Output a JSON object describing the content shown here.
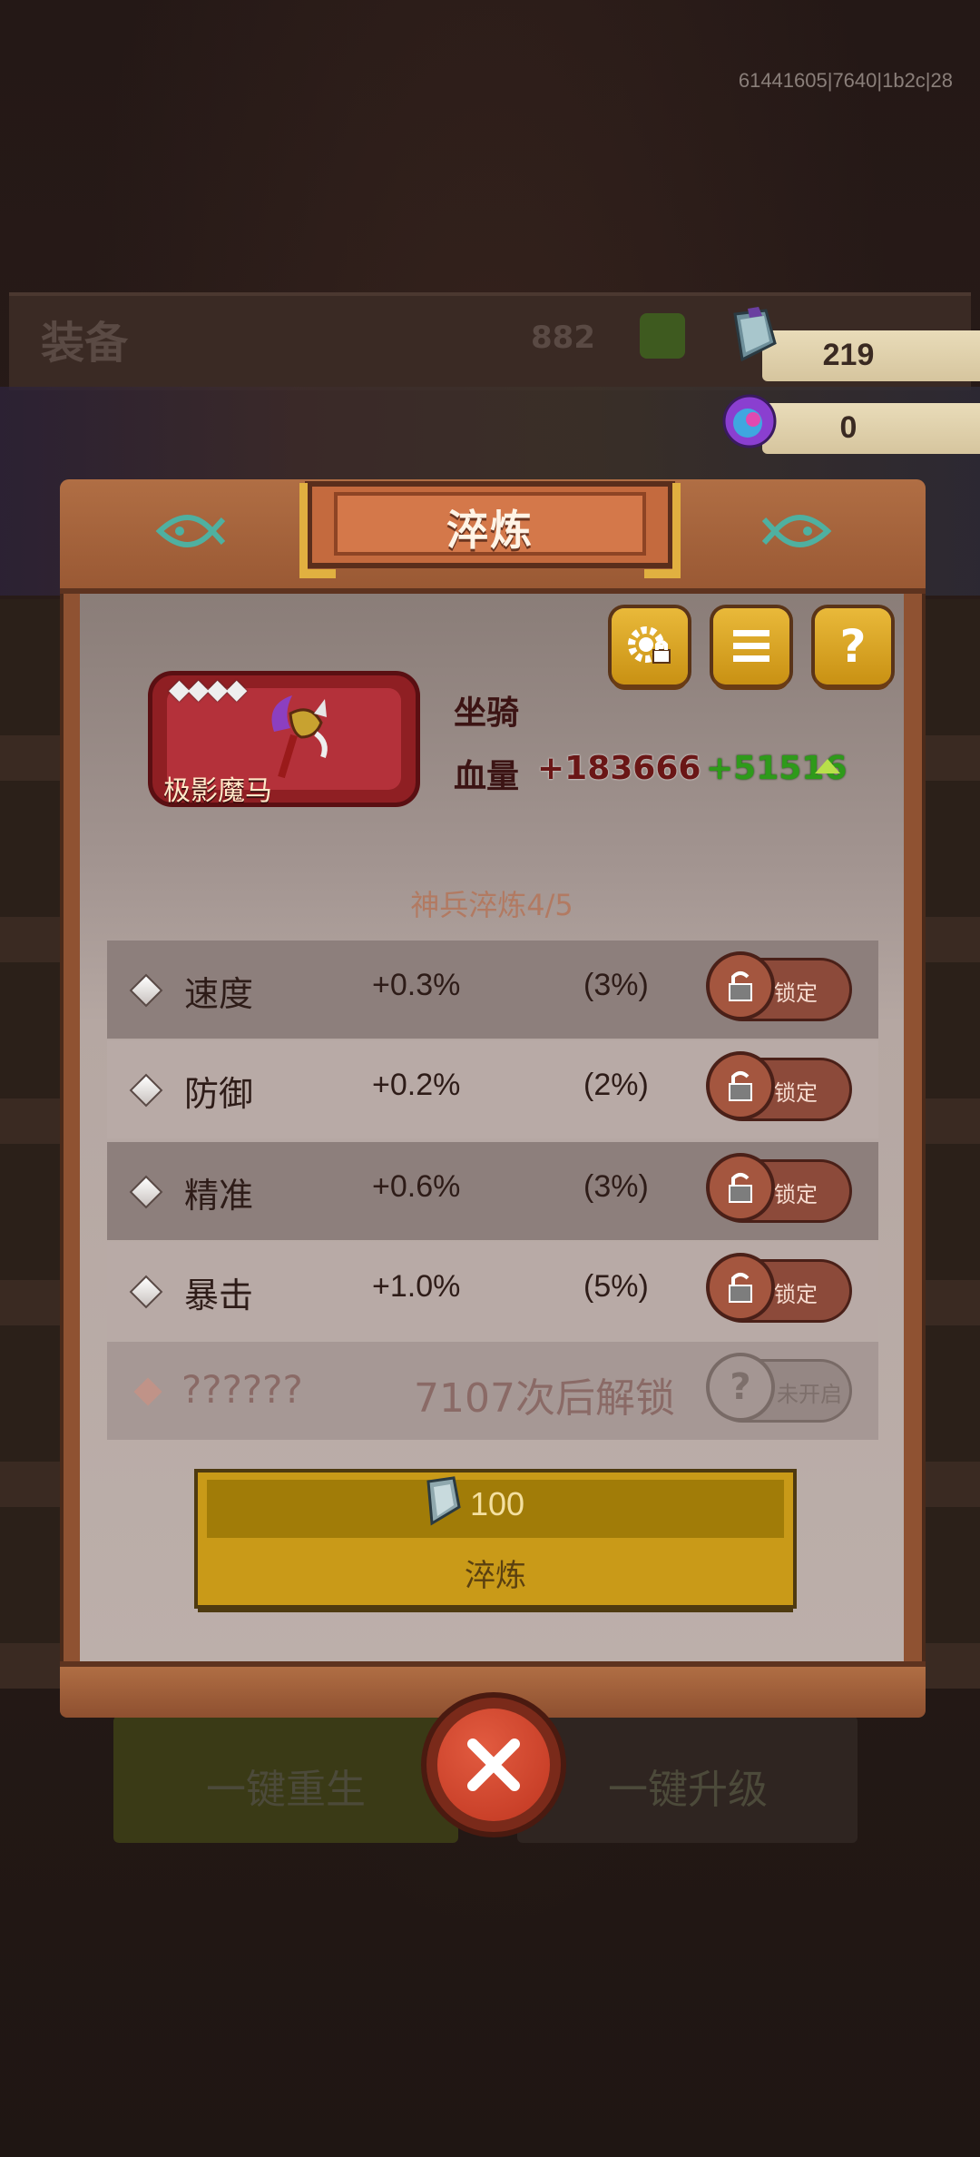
{
  "debug_id": "61441605|7640|1b2c|28",
  "background": {
    "title": "装备",
    "power": "882",
    "button_left": "一键重生",
    "button_right": "一键升级"
  },
  "currency": [
    {
      "icon": "crystal-icon",
      "value": "219"
    },
    {
      "icon": "orb-icon",
      "value": "0"
    }
  ],
  "dialog": {
    "title": "淬炼",
    "item": {
      "name": "极影魔马",
      "stars": "◆◆◆◆",
      "type": "坐骑",
      "hp_label": "血量",
      "hp_value": "+183666",
      "hp_bonus": "+51516"
    },
    "refine_title": "神兵淬炼4/5",
    "stats": [
      {
        "name": "速度",
        "value": "+0.3%",
        "max": "(3%)",
        "lock_label": "锁定"
      },
      {
        "name": "防御",
        "value": "+0.2%",
        "max": "(2%)",
        "lock_label": "锁定"
      },
      {
        "name": "精准",
        "value": "+0.6%",
        "max": "(3%)",
        "lock_label": "锁定"
      },
      {
        "name": "暴击",
        "value": "+1.0%",
        "max": "(5%)",
        "lock_label": "锁定"
      }
    ],
    "locked_slot": {
      "name": "??????",
      "info": "7107次后解锁",
      "btn_label": "未开启"
    },
    "refine_button": {
      "cost": "100",
      "label": "淬炼"
    }
  },
  "colors": {
    "accent_gold": "#c99a18",
    "bonus_green": "#2e9a1a",
    "card_red": "#b4313a"
  }
}
